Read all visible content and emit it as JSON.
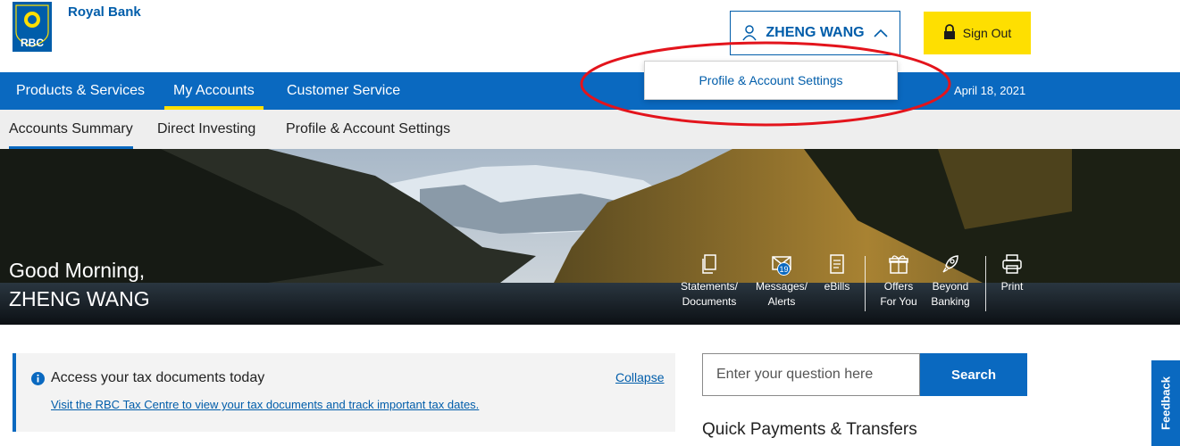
{
  "header": {
    "brand_name": "Royal Bank",
    "logo_text": "RBC",
    "user_name": "ZHENG WANG",
    "sign_out_label": "Sign Out",
    "user_menu_item": "Profile & Account Settings"
  },
  "primary_nav": {
    "items": [
      "Products & Services",
      "My Accounts",
      "Customer Service"
    ],
    "active": "My Accounts",
    "date": "April 18, 2021"
  },
  "secondary_nav": {
    "items": [
      "Accounts Summary",
      "Direct Investing",
      "Profile & Account Settings"
    ],
    "active": "Accounts Summary"
  },
  "hero": {
    "greeting_line1": "Good Morning,",
    "greeting_line2": "ZHENG WANG",
    "actions": [
      {
        "line1": "Statements/",
        "line2": "Documents",
        "icon": "document-icon"
      },
      {
        "line1": "Messages/",
        "line2": "Alerts",
        "icon": "envelope-icon",
        "badge": "19"
      },
      {
        "line1": "eBills",
        "line2": "",
        "icon": "bill-icon"
      },
      {
        "line1": "Offers",
        "line2": "For You",
        "icon": "gift-icon"
      },
      {
        "line1": "Beyond",
        "line2": "Banking",
        "icon": "rocket-icon"
      },
      {
        "line1": "Print",
        "line2": "",
        "icon": "printer-icon"
      }
    ]
  },
  "tax_card": {
    "title": "Access your tax documents today",
    "collapse": "Collapse",
    "link": "Visit the RBC Tax Centre to view your tax documents and track important tax dates."
  },
  "search": {
    "placeholder": "Enter your question here",
    "button": "Search"
  },
  "quick_payments_title": "Quick Payments & Transfers",
  "feedback_label": "Feedback",
  "colors": {
    "brand_blue": "#005daa",
    "nav_blue": "#0a69c0",
    "accent_yellow": "#fedf01",
    "annotation_red": "#e3141c"
  }
}
